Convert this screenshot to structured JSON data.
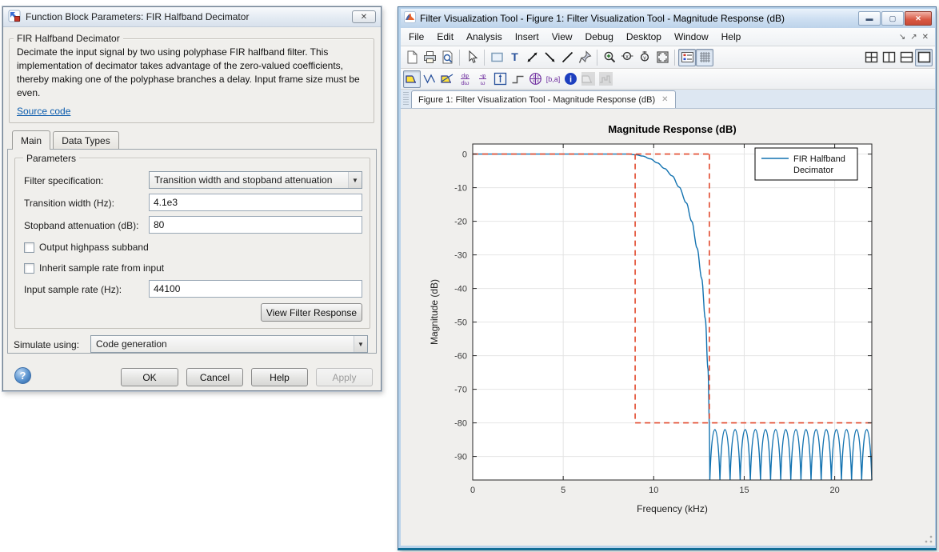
{
  "dialog": {
    "title": "Function Block Parameters: FIR Halfband Decimator",
    "close_glyph": "✕",
    "header": {
      "group_title": "FIR Halfband Decimator",
      "description": "Decimate the input signal by two using polyphase FIR halfband filter. This implementation of decimator takes advantage of the zero-valued coefficients, thereby making one of the polyphase branches a delay. Input frame size must be even.",
      "source_link": "Source code"
    },
    "tabs": [
      {
        "label": "Main",
        "active": true
      },
      {
        "label": "Data Types",
        "active": false
      }
    ],
    "parameters": {
      "group_title": "Parameters",
      "filter_spec": {
        "label": "Filter specification:",
        "value": "Transition width and stopband attenuation"
      },
      "transition_width": {
        "label": "Transition width (Hz):",
        "value": "4.1e3"
      },
      "stopband_atten": {
        "label": "Stopband attenuation (dB):",
        "value": "80"
      },
      "output_highpass": {
        "label": "Output highpass subband",
        "checked": false
      },
      "inherit_rate": {
        "label": "Inherit sample rate from input",
        "checked": false
      },
      "input_rate": {
        "label": "Input sample rate (Hz):",
        "value": "44100"
      },
      "view_response_button": "View Filter Response"
    },
    "simulate_using": {
      "label": "Simulate using:",
      "value": "Code generation"
    },
    "buttons": {
      "ok": {
        "label": "OK",
        "enabled": true
      },
      "cancel": {
        "label": "Cancel",
        "enabled": true
      },
      "help": {
        "label": "Help",
        "enabled": true
      },
      "apply": {
        "label": "Apply",
        "enabled": false
      }
    }
  },
  "fvtool": {
    "title": "Filter Visualization Tool - Figure 1: Filter Visualization Tool - Magnitude Response (dB)",
    "caption_buttons": [
      "minimize",
      "maximize",
      "close"
    ],
    "menu": [
      "File",
      "Edit",
      "Analysis",
      "Insert",
      "View",
      "Debug",
      "Desktop",
      "Window",
      "Help"
    ],
    "menu_controls": [
      {
        "name": "dock-icon",
        "glyph": "↘"
      },
      {
        "name": "float-icon",
        "glyph": "↗"
      },
      {
        "name": "close-menubar-icon",
        "glyph": "✕"
      }
    ],
    "toolbar_main": [
      {
        "name": "new-file-icon"
      },
      {
        "name": "print-icon"
      },
      {
        "name": "print-preview-icon"
      },
      {
        "name": "separator"
      },
      {
        "name": "edit-pointer-icon"
      },
      {
        "name": "separator"
      },
      {
        "name": "insert-rectangle-icon"
      },
      {
        "name": "insert-text-icon"
      },
      {
        "name": "insert-double-arrow-icon"
      },
      {
        "name": "insert-arrow-icon"
      },
      {
        "name": "insert-line-icon"
      },
      {
        "name": "pin-icon"
      },
      {
        "name": "separator"
      },
      {
        "name": "zoom-in-icon"
      },
      {
        "name": "zoom-x-icon"
      },
      {
        "name": "zoom-y-icon"
      },
      {
        "name": "full-view-icon"
      },
      {
        "name": "separator"
      },
      {
        "name": "legend-toggle-icon",
        "state": "selected"
      },
      {
        "name": "grid-toggle-icon",
        "state": "selected"
      }
    ],
    "toolbar_layout": [
      {
        "name": "tile-grid-icon"
      },
      {
        "name": "tile-vertical-icon"
      },
      {
        "name": "tile-horizontal-icon"
      },
      {
        "name": "tile-single-icon",
        "state": "selected"
      }
    ],
    "toolbar_analysis": [
      {
        "name": "magnitude-response-icon",
        "state": "selected"
      },
      {
        "name": "phase-response-icon"
      },
      {
        "name": "magnitude-phase-icon"
      },
      {
        "name": "group-delay-icon"
      },
      {
        "name": "phase-delay-icon"
      },
      {
        "name": "impulse-response-icon"
      },
      {
        "name": "step-response-icon"
      },
      {
        "name": "pole-zero-icon"
      },
      {
        "name": "coefficients-icon"
      },
      {
        "name": "filter-info-icon"
      },
      {
        "name": "magnitude-estimate-icon",
        "state": "disabled"
      },
      {
        "name": "noise-spectrum-icon",
        "state": "disabled"
      }
    ],
    "figure_tab": "Figure 1: Filter Visualization Tool - Magnitude Response (dB)",
    "figure_tab_close_glyph": "✕"
  },
  "chart_data": {
    "type": "line",
    "title": "Magnitude Response (dB)",
    "xlabel": "Frequency (kHz)",
    "ylabel": "Magnitude (dB)",
    "xlim": [
      0,
      22.05
    ],
    "ylim": [
      -97,
      3
    ],
    "xticks": [
      0,
      5,
      10,
      15,
      20
    ],
    "yticks": [
      0,
      -10,
      -20,
      -30,
      -40,
      -50,
      -60,
      -70,
      -80,
      -90
    ],
    "grid": true,
    "legend": {
      "position": "northeast",
      "entries": [
        {
          "label_line1": "FIR Halfband",
          "label_line2": "Decimator",
          "color": "#1272b0"
        }
      ]
    },
    "series": [
      {
        "name": "FIR Halfband Decimator",
        "color": "#1272b0",
        "x": [
          0,
          8.6,
          9.0,
          9.4,
          9.8,
          10.2,
          10.6,
          11.025,
          11.4,
          11.8,
          12.1,
          12.4,
          12.65,
          12.85,
          13.0,
          13.075
        ],
        "y": [
          0,
          0,
          -0.2,
          -0.6,
          -1.4,
          -2.6,
          -4.3,
          -6.5,
          -9.8,
          -14.5,
          -20,
          -28,
          -37,
          -49,
          -64,
          -80
        ]
      }
    ],
    "stopband_ripple": {
      "x_start": 13.1,
      "x_end": 22.05,
      "lobes": 16,
      "peak_db": -82,
      "floor_db": -97
    },
    "mask": {
      "color": "#e2492d",
      "style": "dashed",
      "passband_edge_khz": 8.975,
      "stopband_edge_khz": 13.075,
      "passband_level_db": 0,
      "stopband_level_db": -80
    }
  }
}
